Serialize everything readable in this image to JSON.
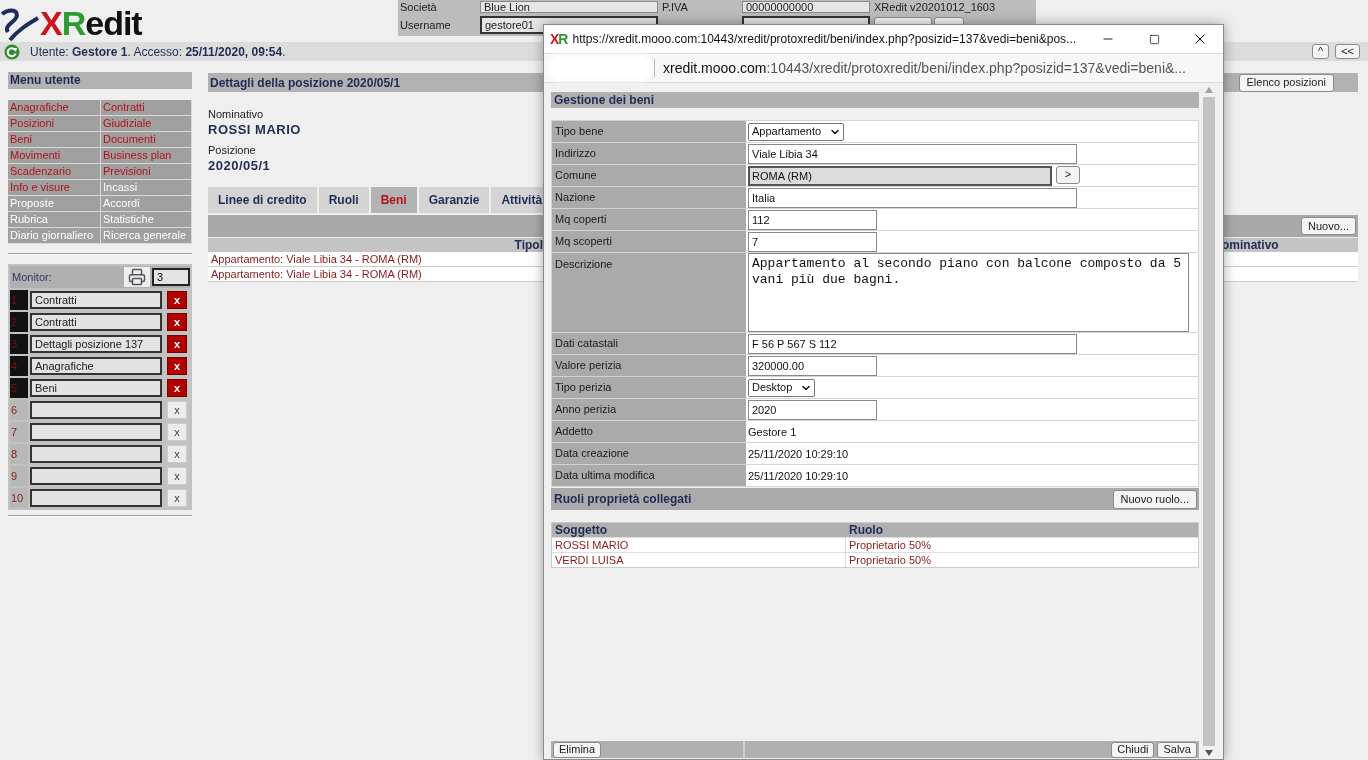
{
  "logo": {
    "parts": [
      {
        "text": "X",
        "color": "#c8161d"
      },
      {
        "text": "R",
        "color": "#2f9a34"
      },
      {
        "text": "edit",
        "color": "#111111"
      }
    ]
  },
  "account": {
    "rows": [
      {
        "label": "Società",
        "value": "Blue Lion"
      },
      {
        "label": "P.IVA",
        "value": "00000000000"
      }
    ],
    "version": "XRedit v20201012_1603",
    "username": {
      "label": "Username",
      "value": "gestore01"
    }
  },
  "status_bar": {
    "text": "Utente: **Gestore 1**. Accesso: **25/11/2020, 09:54**.",
    "buttons": [
      "^",
      "<<"
    ]
  },
  "sidebar": {
    "title": "Menu utente",
    "items": [
      {
        "label": "Anagrafiche",
        "disabled": false
      },
      {
        "label": "Contratti",
        "disabled": false
      },
      {
        "label": "Posizioni",
        "disabled": false
      },
      {
        "label": "Giudiziale",
        "disabled": false
      },
      {
        "label": "Beni",
        "disabled": false
      },
      {
        "label": "Documenti",
        "disabled": false
      },
      {
        "label": "Movimenti",
        "disabled": false
      },
      {
        "label": "Business plan",
        "disabled": false
      },
      {
        "label": "Scadenzario",
        "disabled": false
      },
      {
        "label": "Previsioni",
        "disabled": false
      },
      {
        "label": "Info e visure",
        "disabled": false
      },
      {
        "label": "Incassi",
        "disabled": true
      },
      {
        "label": "Proposte",
        "disabled": true
      },
      {
        "label": "Accordi",
        "disabled": true
      },
      {
        "label": "Rubrica",
        "disabled": true
      },
      {
        "label": "Statistiche",
        "disabled": true
      },
      {
        "label": "Diario giornaliero",
        "disabled": true
      },
      {
        "label": "Ricerca generale",
        "disabled": true
      }
    ]
  },
  "monitor": {
    "label": "Monitor:",
    "count": "3",
    "slots": [
      {
        "number": "1",
        "value": "Contratti",
        "active": true,
        "close": "x"
      },
      {
        "number": "2",
        "value": "Contratti",
        "active": true,
        "close": "x"
      },
      {
        "number": "3",
        "value": "Dettagli posizione 137",
        "active": true,
        "close": "x"
      },
      {
        "number": "4",
        "value": "Anagrafiche",
        "active": true,
        "close": "x"
      },
      {
        "number": "5",
        "value": "Beni",
        "active": true,
        "close": "x"
      },
      {
        "number": "6",
        "active": false,
        "close": "x"
      },
      {
        "number": "7",
        "active": false,
        "close": "x"
      },
      {
        "number": "8",
        "active": false,
        "close": "x"
      },
      {
        "number": "9",
        "active": false,
        "close": "x"
      },
      {
        "number": "10",
        "active": false,
        "close": "x"
      }
    ]
  },
  "main": {
    "title": "Dettagli della posizione 2020/05/1",
    "button": "Elenco posizioni",
    "fields": [
      {
        "label": "Nominativo",
        "value": "ROSSI MARIO"
      },
      {
        "label": "Posizione",
        "value": "2020/05/1"
      }
    ],
    "tabs": [
      {
        "label": "Linee di credito",
        "selected": false
      },
      {
        "label": "Ruoli",
        "selected": false
      },
      {
        "label": "Beni",
        "selected": true
      },
      {
        "label": "Garanzie",
        "selected": false
      },
      {
        "label": "Attività",
        "selected": false
      }
    ],
    "new_button": "Nuovo...",
    "table": {
      "columns": [
        "Tipol",
        "ominativo"
      ],
      "rows": [
        [
          "Appartamento: Viale Libia 34 - ROMA (RM)"
        ],
        [
          "Appartamento: Viale Libia 34 - ROMA (RM)"
        ]
      ]
    }
  },
  "popup": {
    "icon": [
      {
        "text": "X",
        "color": "#c8161d"
      },
      {
        "text": "R",
        "color": "#2f9a34"
      }
    ],
    "title": "https://xredit.mooo.com:10443/xredit/protoxredit/beni/index.php?posizid=137&vedi=beni&pos...",
    "address_host": "xredit.mooo.com",
    "address_path": ":10443/xredit/protoxredit/beni/index.php?posizid=137&vedi=beni&...",
    "section": "Gestione dei beni",
    "fields": [
      {
        "label": "Tipo bene",
        "kind": "select",
        "value": "Appartamento"
      },
      {
        "label": "Indirizzo",
        "kind": "text",
        "value": "Viale Libia 34"
      },
      {
        "label": "Comune",
        "kind": "lookup",
        "value": "ROMA (RM)",
        "button": ">"
      },
      {
        "label": "Nazione",
        "kind": "text",
        "value": "Italia"
      },
      {
        "label": "Mq coperti",
        "kind": "short",
        "value": "112"
      },
      {
        "label": "Mq scoperti",
        "kind": "short",
        "value": "7"
      },
      {
        "label": "Descrizione",
        "kind": "textarea",
        "value": "Appartamento al secondo piano con balcone composto da 5 vani più due bagni."
      },
      {
        "label": "Dati catastali",
        "kind": "text",
        "value": "F 56 P 567 S 112"
      },
      {
        "label": "Valore perizia",
        "kind": "short",
        "value": "320000.00"
      },
      {
        "label": "Tipo perizia",
        "kind": "select",
        "value": "Desktop"
      },
      {
        "label": "Anno perizia",
        "kind": "short",
        "value": "2020"
      },
      {
        "label": "Addetto",
        "kind": "static",
        "value": "Gestore 1"
      },
      {
        "label": "Data creazione",
        "kind": "static",
        "value": "25/11/2020 10:29:10"
      },
      {
        "label": "Data ultima modifica",
        "kind": "static",
        "value": "25/11/2020 10:29:10"
      }
    ],
    "roles": {
      "title": "Ruoli proprietà collegati",
      "button": "Nuovo ruolo...",
      "columns": [
        "Soggetto",
        "Ruolo"
      ],
      "rows": [
        [
          "ROSSI MARIO",
          "Proprietario 50%"
        ],
        [
          "VERDI LUISA",
          "Proprietario 50%"
        ]
      ]
    },
    "footer": {
      "left": [
        "Elimina"
      ],
      "right": [
        "Chiudi",
        "Salva"
      ]
    }
  }
}
